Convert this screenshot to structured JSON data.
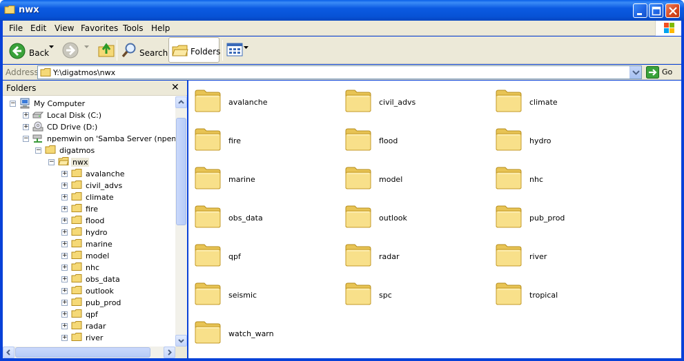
{
  "window": {
    "title": "nwx"
  },
  "menu": [
    "File",
    "Edit",
    "View",
    "Favorites",
    "Tools",
    "Help"
  ],
  "toolbar": {
    "back_label": "Back",
    "search_label": "Search",
    "folders_label": "Folders"
  },
  "address": {
    "label": "Address",
    "value": "Y:\\digatmos\\nwx",
    "go_label": "Go"
  },
  "folders_pane": {
    "title": "Folders",
    "close": "✕",
    "tree": [
      {
        "label": "My Computer",
        "icon": "computer-icon",
        "level": 0,
        "expander": "−"
      },
      {
        "label": "Local Disk (C:)",
        "icon": "hard-disk-icon",
        "level": 1,
        "expander": "+"
      },
      {
        "label": "CD Drive (D:)",
        "icon": "cd-drive-icon",
        "level": 1,
        "expander": "+"
      },
      {
        "label": "npemwin on 'Samba Server (npemwin)'",
        "icon": "network-drive-icon",
        "level": 1,
        "expander": "−"
      },
      {
        "label": "digatmos",
        "icon": "folder-icon",
        "level": 2,
        "expander": "−"
      },
      {
        "label": "nwx",
        "icon": "open-folder-icon",
        "level": 3,
        "expander": "−",
        "selected": true
      },
      {
        "label": "avalanche",
        "icon": "folder-icon",
        "level": 4,
        "expander": "+"
      },
      {
        "label": "civil_advs",
        "icon": "folder-icon",
        "level": 4,
        "expander": "+"
      },
      {
        "label": "climate",
        "icon": "folder-icon",
        "level": 4,
        "expander": "+"
      },
      {
        "label": "fire",
        "icon": "folder-icon",
        "level": 4,
        "expander": "+"
      },
      {
        "label": "flood",
        "icon": "folder-icon",
        "level": 4,
        "expander": "+"
      },
      {
        "label": "hydro",
        "icon": "folder-icon",
        "level": 4,
        "expander": "+"
      },
      {
        "label": "marine",
        "icon": "folder-icon",
        "level": 4,
        "expander": "+"
      },
      {
        "label": "model",
        "icon": "folder-icon",
        "level": 4,
        "expander": "+"
      },
      {
        "label": "nhc",
        "icon": "folder-icon",
        "level": 4,
        "expander": "+"
      },
      {
        "label": "obs_data",
        "icon": "folder-icon",
        "level": 4,
        "expander": "+"
      },
      {
        "label": "outlook",
        "icon": "folder-icon",
        "level": 4,
        "expander": "+"
      },
      {
        "label": "pub_prod",
        "icon": "folder-icon",
        "level": 4,
        "expander": "+"
      },
      {
        "label": "qpf",
        "icon": "folder-icon",
        "level": 4,
        "expander": "+"
      },
      {
        "label": "radar",
        "icon": "folder-icon",
        "level": 4,
        "expander": "+"
      },
      {
        "label": "river",
        "icon": "folder-icon",
        "level": 4,
        "expander": "+"
      }
    ]
  },
  "content": {
    "folders": [
      "avalanche",
      "civil_advs",
      "climate",
      "fire",
      "flood",
      "hydro",
      "marine",
      "model",
      "nhc",
      "obs_data",
      "outlook",
      "pub_prod",
      "qpf",
      "radar",
      "river",
      "seismic",
      "spc",
      "tropical",
      "watch_warn"
    ]
  },
  "colors": {
    "titlebar": "#0841d8",
    "chrome": "#ece9d8",
    "folder": "#f5d977"
  }
}
